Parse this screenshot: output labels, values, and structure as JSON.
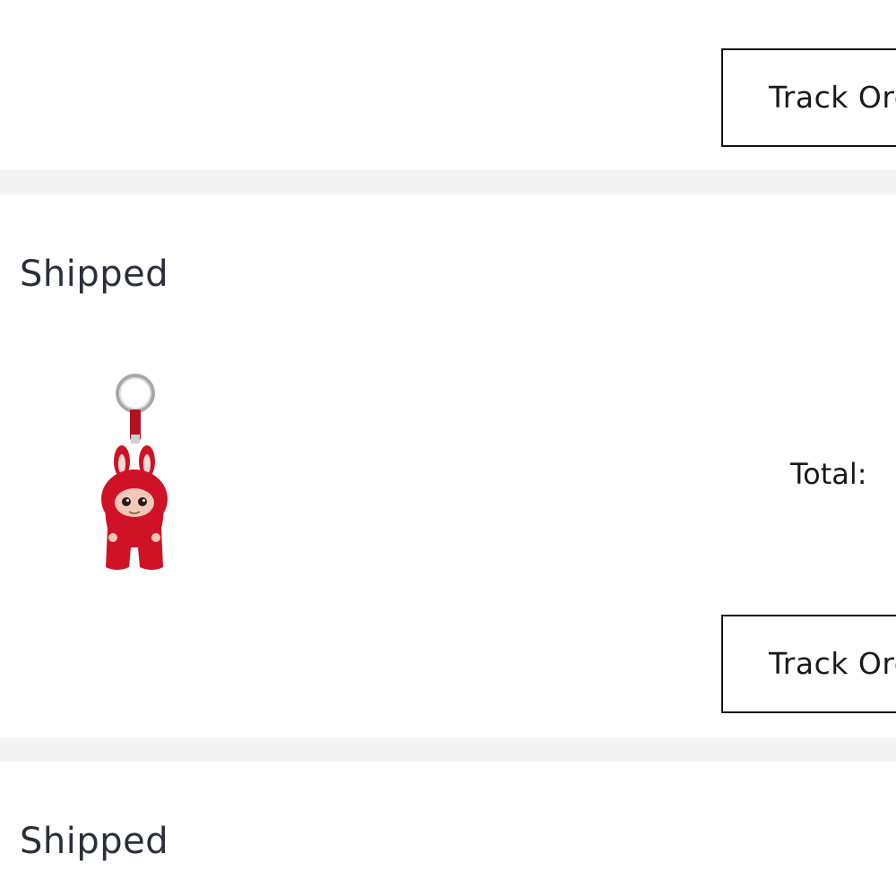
{
  "orders": [
    {
      "track_label": "Track Order"
    },
    {
      "status": "Shipped",
      "product_image": "red-bunny-plush-keychain",
      "total_label": "Total:",
      "track_label": "Track Order"
    },
    {
      "status": "Shipped"
    }
  ],
  "colors": {
    "separator": "#f4f4f4",
    "status_text": "#2b2f3a",
    "button_border": "#111111",
    "product_red": "#d01226"
  }
}
